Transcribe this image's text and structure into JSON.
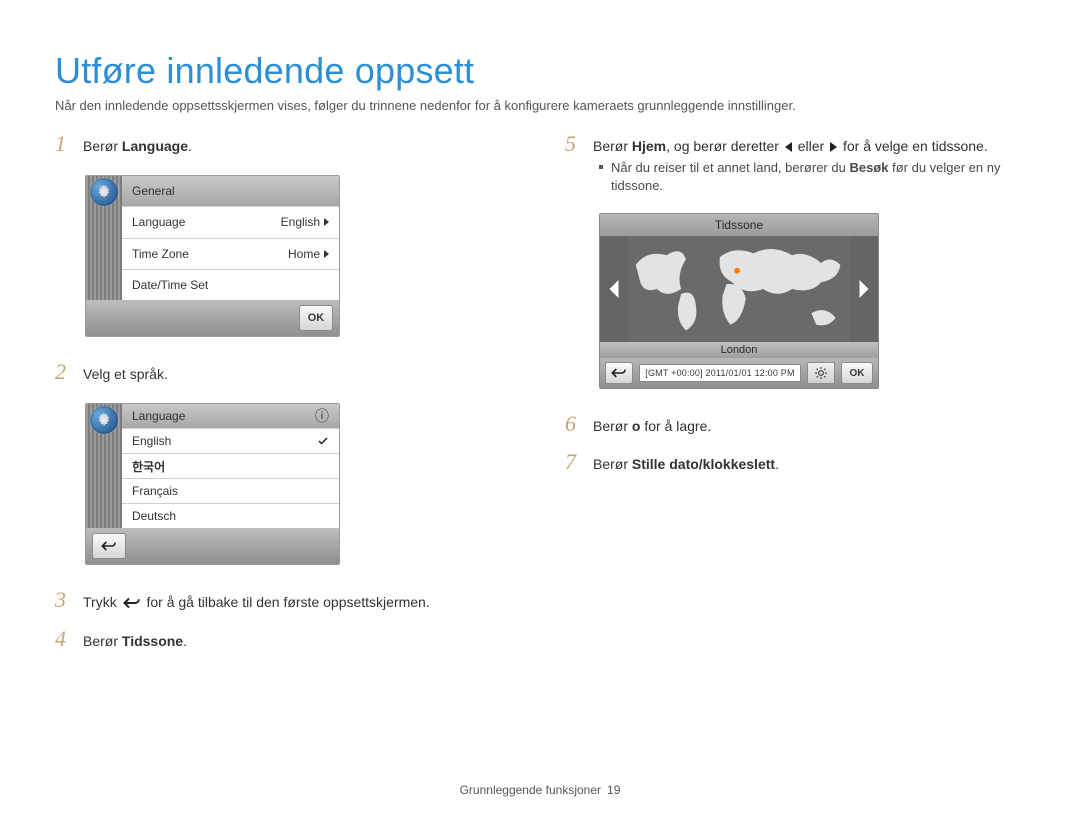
{
  "title": "Utføre innledende oppsett",
  "intro": "Når den innledende oppsettsskjermen vises, følger du trinnene nedenfor for å konfigurere kameraets grunnleggende innstillinger.",
  "steps": {
    "s1": {
      "num": "1",
      "prefix": "Berør ",
      "bold": "Language",
      "suffix": "."
    },
    "s2": {
      "num": "2",
      "text": "Velg et språk."
    },
    "s3": {
      "num": "3",
      "prefix": "Trykk ",
      "suffix": " for å gå tilbake til den første oppsettskjermen."
    },
    "s4": {
      "num": "4",
      "prefix": "Berør ",
      "bold": "Tidssone",
      "suffix": "."
    },
    "s5": {
      "num": "5",
      "prefix": "Berør ",
      "bold": "Hjem",
      "mid": ", og berør deretter ",
      "tail": " for å velge en tidssone."
    },
    "s5_bullet": {
      "prefix": "Når du reiser til et annet land, berører du ",
      "bold": "Besøk",
      "suffix": " før du velger en ny tidssone."
    },
    "s6": {
      "num": "6",
      "prefix": "Berør ",
      "ok": "o",
      "suffix": " for å lagre."
    },
    "s7": {
      "num": "7",
      "prefix": "Berør ",
      "bold": "Stille dato/klokkeslett",
      "suffix": "."
    }
  },
  "screen1": {
    "header": "General",
    "rows": [
      {
        "label": "Language",
        "value": "English"
      },
      {
        "label": "Time Zone",
        "value": "Home"
      },
      {
        "label": "Date/Time Set",
        "value": ""
      }
    ],
    "ok": "OK"
  },
  "screen2": {
    "header": "Language",
    "langs": [
      "English",
      "한국어",
      "Français",
      "Deutsch"
    ]
  },
  "tz": {
    "title": "Tidssone",
    "city": "London",
    "gmt": "[GMT +00:00]   2011/01/01   12:00 PM",
    "ok": "OK"
  },
  "footer": {
    "section": "Grunnleggende funksjoner",
    "page": "19"
  }
}
